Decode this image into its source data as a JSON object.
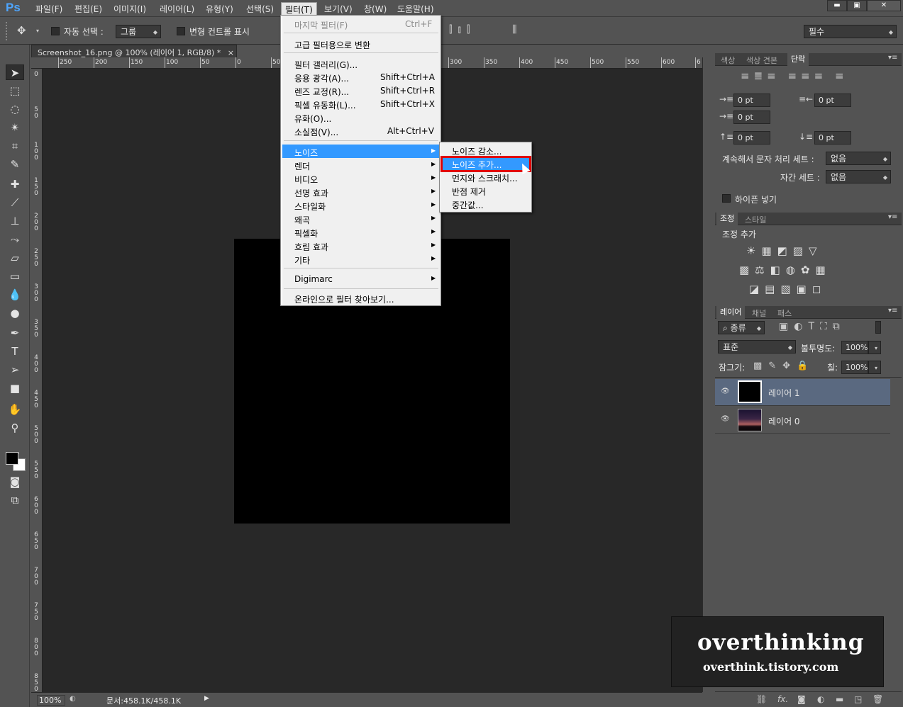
{
  "app": {
    "logo": "Ps"
  },
  "menubar": {
    "items": [
      "파일(F)",
      "편집(E)",
      "이미지(I)",
      "레이어(L)",
      "유형(Y)",
      "선택(S)",
      "필터(T)",
      "보기(V)",
      "창(W)",
      "도움말(H)"
    ],
    "active": "필터(T)"
  },
  "window_buttons": {
    "minimize": "▬",
    "maximize": "▣",
    "close": "✕"
  },
  "options": {
    "auto_select_label": "자동 선택 :",
    "auto_select_value": "그룹",
    "transform_label": "변형 컨트롤 표시",
    "workspace_value": "필수"
  },
  "document": {
    "tab_title": "Screenshot_16.png @ 100% (레이어 1, RGB/8) *",
    "tab_close": "×",
    "canvas_color": "#000000"
  },
  "ruler_top": [
    "250",
    "200",
    "150",
    "100",
    "50",
    "0",
    "50",
    "300",
    "350",
    "400",
    "450",
    "500",
    "550",
    "600",
    "6"
  ],
  "ruler_left": [
    "0",
    "5 0",
    "1 0 0",
    "1 5 0",
    "2 0 0",
    "2 5 0",
    "3 0 0",
    "3 5 0",
    "4 0 0",
    "4 5 0",
    "5 0 0",
    "5 5 0",
    "6 0 0",
    "6 5 0",
    "7 0 0",
    "7 5 0",
    "8 0 0",
    "8 5 0"
  ],
  "filter_menu": {
    "items": [
      {
        "label": "마지막 필터(F)",
        "shortcut": "Ctrl+F",
        "disabled": true
      },
      {
        "label": "고급 필터용으로 변환"
      },
      {
        "label": "필터 갤러리(G)..."
      },
      {
        "label": "응용 광각(A)...",
        "shortcut": "Shift+Ctrl+A"
      },
      {
        "label": "렌즈 교정(R)...",
        "shortcut": "Shift+Ctrl+R"
      },
      {
        "label": "픽셀 유동화(L)...",
        "shortcut": "Shift+Ctrl+X"
      },
      {
        "label": "유화(O)..."
      },
      {
        "label": "소실점(V)...",
        "shortcut": "Alt+Ctrl+V"
      },
      {
        "label": "노이즈",
        "highlighted": true
      },
      {
        "label": "렌더"
      },
      {
        "label": "비디오"
      },
      {
        "label": "선명 효과"
      },
      {
        "label": "스타일화"
      },
      {
        "label": "왜곡"
      },
      {
        "label": "픽셀화"
      },
      {
        "label": "흐림 효과"
      },
      {
        "label": "기타"
      },
      {
        "label": "Digimarc"
      },
      {
        "label": "온라인으로 필터 찾아보기..."
      }
    ]
  },
  "noise_submenu": {
    "items": [
      "노이즈 감소...",
      "노이즈 추가...",
      "먼지와 스크래치...",
      "반점 제거",
      "중간값..."
    ],
    "selected": "노이즈 추가..."
  },
  "paragraph_panel": {
    "tabs": [
      "색상",
      "색상 견본",
      "단락"
    ],
    "active_tab": "단락",
    "fields": [
      "0 pt",
      "0 pt",
      "0 pt",
      "0 pt",
      "0 pt"
    ],
    "kinsoku_label": "계속해서 문자 처리 세트 :",
    "kinsoku_value": "없음",
    "mojikumi_label": "자간 세트 :",
    "mojikumi_value": "없음",
    "hyphen_label": "하이픈 넣기"
  },
  "adjust_panel": {
    "tabs": [
      "조정",
      "스타일"
    ],
    "title": "조정 추가"
  },
  "layers_panel": {
    "tabs": [
      "레이어",
      "채널",
      "패스"
    ],
    "filter_label": "종류",
    "blend_mode": "표준",
    "opacity_label": "불투명도:",
    "opacity_value": "100%",
    "lock_label": "잠그기:",
    "fill_label": "칠:",
    "fill_value": "100%",
    "layers": [
      {
        "name": "레이어 1",
        "selected": true
      },
      {
        "name": "레이어 0",
        "selected": false
      }
    ],
    "footer_icons": [
      "link-icon",
      "fx-icon",
      "mask-icon",
      "adjustment-icon",
      "folder-icon",
      "new-layer-icon",
      "trash-icon"
    ],
    "fx_label": "fx."
  },
  "status": {
    "zoom": "100%",
    "doc": "문서:458.1K/458.1K",
    "arrow": "▶"
  },
  "watermark": {
    "title": "overthinking",
    "url": "overthink.tistory.com"
  },
  "colors": {
    "accent": "#3399ff",
    "highlight_box": "#e00000",
    "panel": "#535353",
    "canvas": "#282828"
  }
}
